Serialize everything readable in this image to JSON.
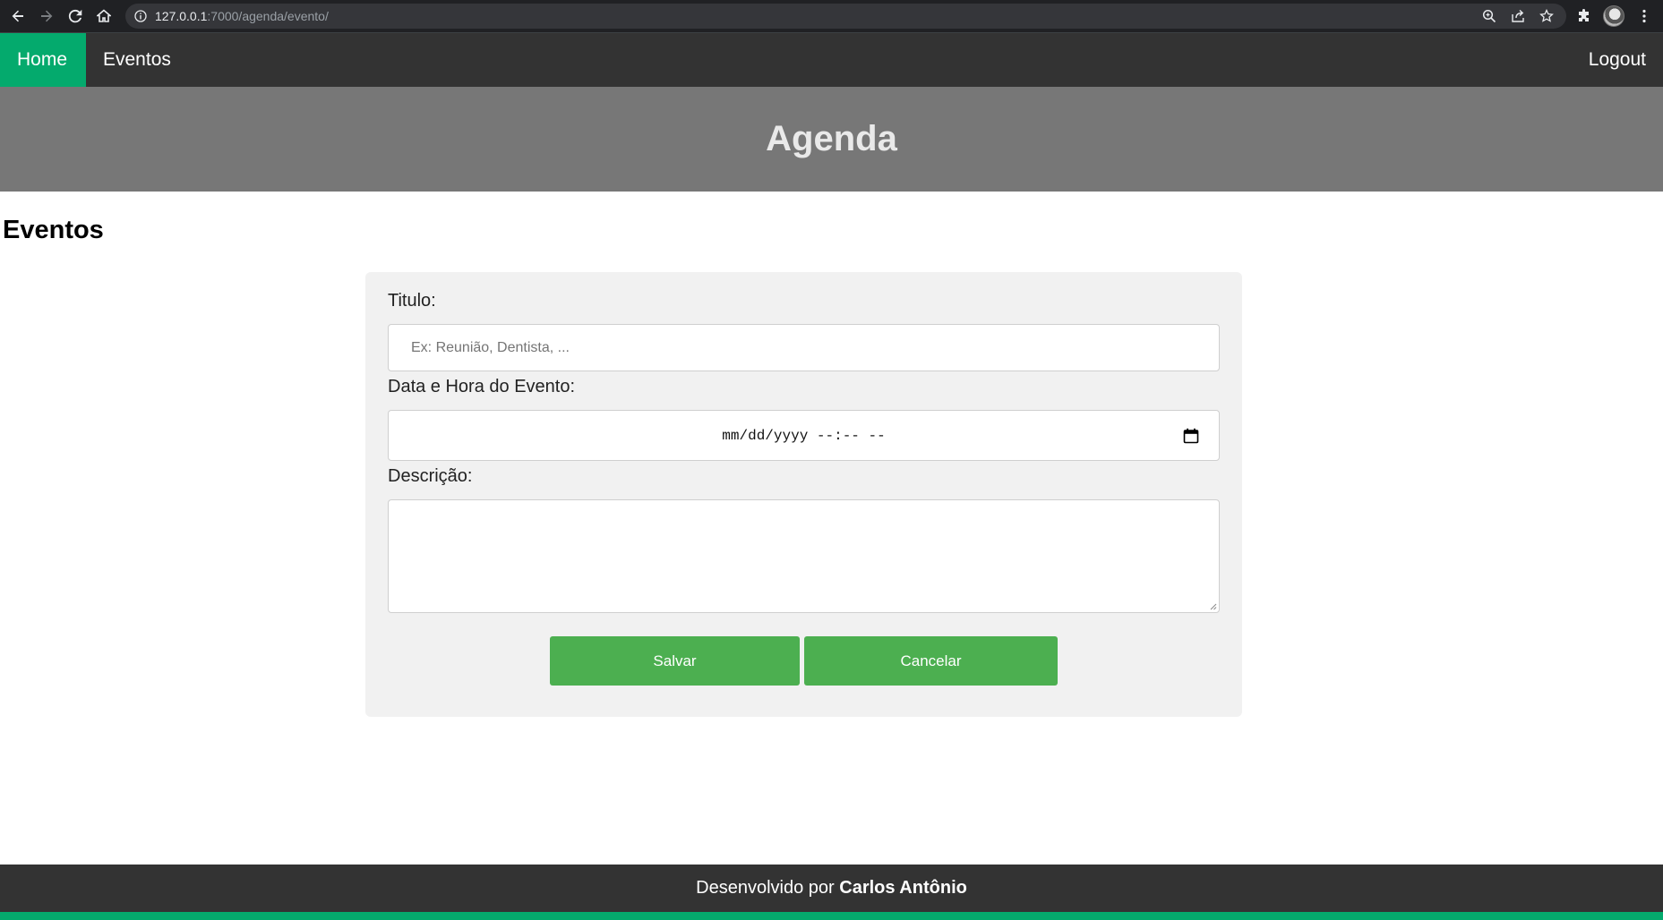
{
  "browser": {
    "url_host": "127.0.0.1",
    "url_rest": ":7000/agenda/evento/"
  },
  "nav": {
    "home": "Home",
    "eventos": "Eventos",
    "logout": "Logout"
  },
  "banner": {
    "title": "Agenda"
  },
  "page": {
    "title": "Eventos"
  },
  "form": {
    "titulo_label": "Titulo:",
    "titulo_placeholder": "Ex: Reunião, Dentista, ...",
    "titulo_value": "",
    "data_label": "Data e Hora do Evento:",
    "data_placeholder": "mm/dd/yyyy --:-- --",
    "descricao_label": "Descrição:",
    "descricao_value": "",
    "save_label": "Salvar",
    "cancel_label": "Cancelar"
  },
  "footer": {
    "prefix": "Desenvolvido por",
    "author": "Carlos Antônio"
  },
  "colors": {
    "nav_active": "#04aa6d",
    "nav_bg": "#333333",
    "banner_bg": "#777777",
    "button": "#4caf50"
  }
}
